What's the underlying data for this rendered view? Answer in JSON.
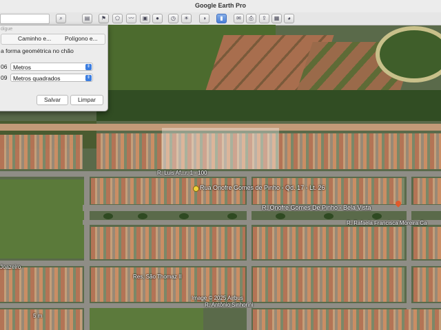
{
  "window": {
    "title": "Google Earth Pro"
  },
  "toolbar": {
    "search_value": "",
    "buttons": [
      "search",
      "sidebar",
      "placemark",
      "polygon",
      "path",
      "overlay",
      "tour",
      "historical",
      "sun",
      "planets",
      "ruler",
      "email",
      "print",
      "save-image",
      "map",
      "google-maps"
    ]
  },
  "dialog": {
    "header": "ólgue",
    "tabs": [
      "Caminho e...",
      "Polígono e..."
    ],
    "description": "a forma geométrica no chão",
    "perimeter": {
      "value": "06",
      "unit": "Metros"
    },
    "area": {
      "value": "09",
      "unit": "Metros quadrados"
    },
    "save_label": "Salvar",
    "clear_label": "Limpar"
  },
  "map": {
    "labels": {
      "street_1": "R. Luis Af...r. 1 - 100",
      "address": "Rua Onofre Gomes de Pinho - Qd. 17 - Lt. 26",
      "street_2": "R. Onofre Gomes De Pinho - Bela Vista",
      "street_3": "R. Rafaela Francisca Moreira Ca",
      "street_4": "Joazeiro",
      "street_5": "R. Antônio Sinhorini",
      "street_6": "Res. São Thomaz II",
      "copyright": "Image © 2025 Airbus",
      "scale": "5 m"
    },
    "accent": "#e05a2b"
  }
}
